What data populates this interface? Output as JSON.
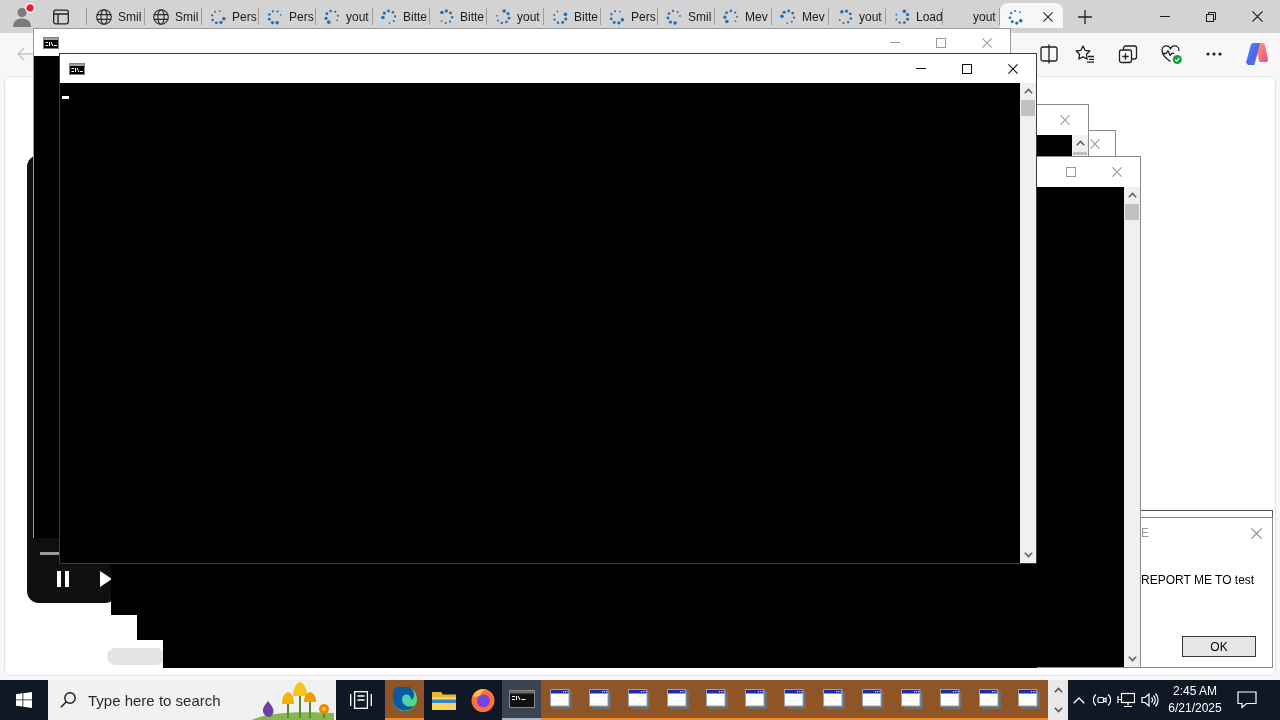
{
  "browser": {
    "profile": {
      "notification": true
    },
    "tabs": [
      {
        "label": "Smil",
        "kind": "globe",
        "selected": false
      },
      {
        "label": "Smil",
        "kind": "globe",
        "selected": false
      },
      {
        "label": "Pers",
        "kind": "loading",
        "selected": false
      },
      {
        "label": "Pers",
        "kind": "loading",
        "selected": false
      },
      {
        "label": "yout",
        "kind": "loading",
        "selected": false
      },
      {
        "label": "Bitte",
        "kind": "loading",
        "selected": false
      },
      {
        "label": "Bitte",
        "kind": "loading",
        "selected": false
      },
      {
        "label": "yout",
        "kind": "loading",
        "selected": false
      },
      {
        "label": "Bitte",
        "kind": "loading",
        "selected": false
      },
      {
        "label": "Pers",
        "kind": "loading",
        "selected": false
      },
      {
        "label": "Smil",
        "kind": "loading",
        "selected": false
      },
      {
        "label": "Mev",
        "kind": "loading",
        "selected": false
      },
      {
        "label": "Mev",
        "kind": "loading",
        "selected": false
      },
      {
        "label": "yout",
        "kind": "loading",
        "selected": false
      },
      {
        "label": "Load",
        "kind": "loading",
        "selected": false
      },
      {
        "label": "yout",
        "kind": "plain",
        "selected": false
      },
      {
        "kind": "loading",
        "selected": true
      }
    ],
    "toolbar": [
      {
        "kind": "back",
        "disabled": true
      },
      {
        "kind": "split-screen",
        "disabled": false
      },
      {
        "kind": "favorites",
        "disabled": false
      },
      {
        "kind": "collections",
        "disabled": false
      },
      {
        "kind": "essentials",
        "disabled": false
      },
      {
        "kind": "more",
        "disabled": false
      },
      {
        "kind": "copilot",
        "disabled": false
      }
    ]
  },
  "page": {
    "video_player": {
      "playing": true
    }
  },
  "console_windows": [
    {
      "active": false
    },
    {
      "active": true,
      "cursor": true
    },
    {
      "active": false
    },
    {
      "active": false
    },
    {
      "active": false
    }
  ],
  "message_box": {
    "title": "E",
    "text": "REPORT ME TO test",
    "button": "OK"
  },
  "taskbar": {
    "search": {
      "placeholder": "Type here to search"
    },
    "buttons": [
      {
        "kind": "task-view",
        "flashing": false,
        "active": false
      },
      {
        "kind": "edge",
        "flashing": true,
        "active": false
      },
      {
        "kind": "explorer",
        "flashing": false,
        "active": false
      },
      {
        "kind": "firefox",
        "flashing": false,
        "active": false
      },
      {
        "kind": "console",
        "flashing": false,
        "active": true
      },
      {
        "kind": "window",
        "flashing": true,
        "active": false
      },
      {
        "kind": "window",
        "flashing": true,
        "active": false
      },
      {
        "kind": "window",
        "flashing": true,
        "active": false
      },
      {
        "kind": "window",
        "flashing": true,
        "active": false
      },
      {
        "kind": "window",
        "flashing": true,
        "active": false
      },
      {
        "kind": "window",
        "flashing": true,
        "active": false
      },
      {
        "kind": "window",
        "flashing": true,
        "active": false
      },
      {
        "kind": "window",
        "flashing": true,
        "active": false
      },
      {
        "kind": "window",
        "flashing": true,
        "active": false
      },
      {
        "kind": "window",
        "flashing": true,
        "active": false
      },
      {
        "kind": "window",
        "flashing": true,
        "active": false
      },
      {
        "kind": "window",
        "flashing": true,
        "active": false
      },
      {
        "kind": "window",
        "flashing": true,
        "active": false
      }
    ],
    "tray": [
      {
        "kind": "chevron"
      },
      {
        "kind": "meet"
      },
      {
        "kind": "network"
      },
      {
        "kind": "volume"
      }
    ],
    "clock": {
      "time": "2:45 AM",
      "date": "6/21/2025"
    }
  }
}
